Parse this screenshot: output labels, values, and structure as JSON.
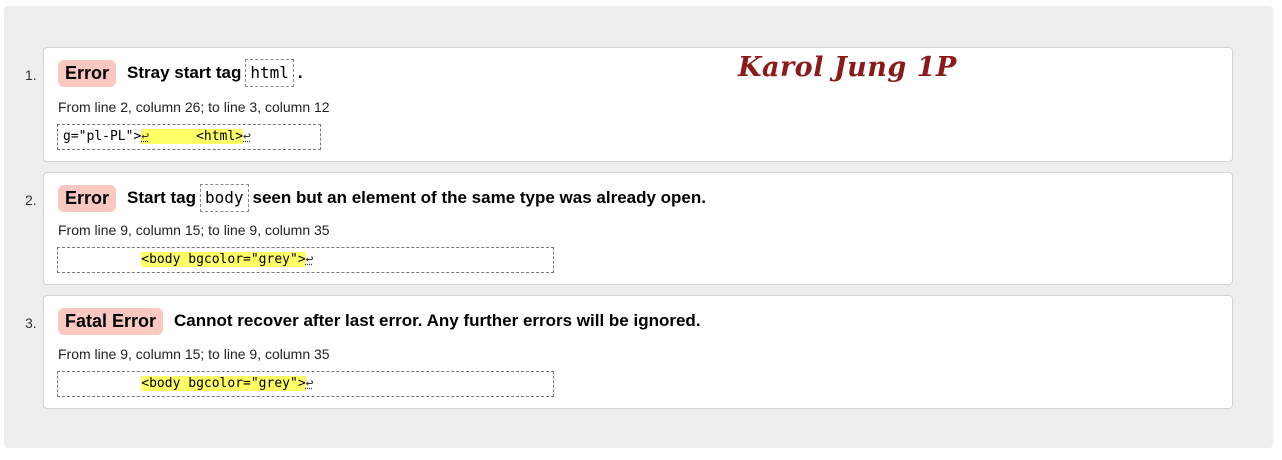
{
  "signature": "Karol Jung 1P",
  "messages": [
    {
      "number": "1.",
      "badge": "Error",
      "text_before": "Stray start tag",
      "tag": "html",
      "text_after": ".",
      "location": "From line 2, column 26; to line 3, column 12",
      "extract": {
        "before": "g=\"pl-PL\">",
        "lf1": "↩",
        "highlight": "      <html>",
        "lf2": "↩"
      }
    },
    {
      "number": "2.",
      "badge": "Error",
      "text_before": "Start tag",
      "tag": "body",
      "text_after": "seen but an element of the same type was already open.",
      "location": "From line 9, column 15; to line 9, column 35",
      "extract": {
        "before": "          ",
        "highlight": "<body bgcolor=\"grey\">",
        "lf": "↩"
      }
    },
    {
      "number": "3.",
      "badge": "Fatal Error",
      "text": "Cannot recover after last error. Any further errors will be ignored.",
      "location": "From line 9, column 15; to line 9, column 35",
      "extract": {
        "before": "          ",
        "highlight": "<body bgcolor=\"grey\">",
        "lf": "↩"
      }
    }
  ]
}
